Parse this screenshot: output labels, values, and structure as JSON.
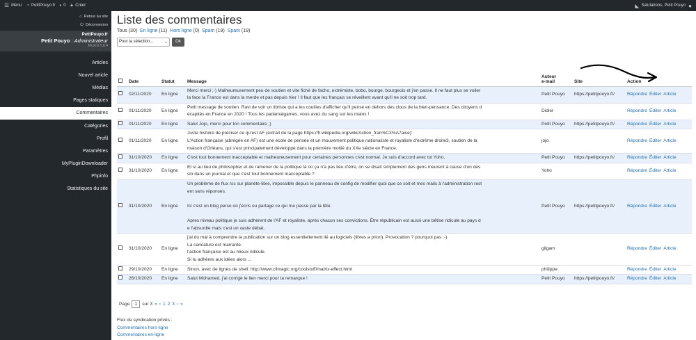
{
  "topbar": {
    "menu": "Menu",
    "site": "PetitPouyo.fr",
    "comments_count": "0",
    "create": "Créer",
    "greeting": "Salutations, Petit Pouyo"
  },
  "sidebar": {
    "back_link": "Retour au site",
    "logout": "Déconnexion",
    "site_name": "PetitPouyo.fr",
    "user_name": "Petit Pouyo",
    "user_role": "Administrateur",
    "version": "PluXml 5.8.4",
    "menu": [
      "Articles",
      "Nouvel article",
      "Médias",
      "Pages statiques",
      "Commentaires",
      "Catégories",
      "Profil",
      "Paramètres",
      "MyPluginDownloader",
      "Phpinfo",
      "Statistiques du site"
    ],
    "active": "Commentaires"
  },
  "page": {
    "title": "Liste des commentaires",
    "filters": {
      "all": "Tous (30)",
      "online": "En ligne",
      "online_count": "(11)",
      "offline": "Hors ligne",
      "offline_count": "(0)",
      "spam_a": "Spam",
      "spam_a_count": "(19)",
      "spam_b": "Spam",
      "spam_b_count": "(19)"
    },
    "bulk_select": "Pour la sélection...",
    "ok": "Ok"
  },
  "table": {
    "headers": {
      "date": "Date",
      "status": "Statut",
      "message": "Message",
      "author_a": "Auteur",
      "author_b": "e-mail",
      "site": "Site",
      "action": "Action"
    },
    "reply": "Répondre",
    "edit_comment": "Éditer",
    "article": "Article",
    "rows": [
      {
        "date": "02/11/2020",
        "status": "En ligne",
        "message": [
          "Merci merci ;-) Malheureusement peu de soutien et vite fiché de facho, extrémiste, bobo, bourge, bourgeois et j'en passe. Il ne faut plus se voiler",
          "la face la France est dans la merde et pas depuis hier ! Il faut que les français se réveillent avant qu'il ne soit trop tard."
        ],
        "author": "Petit Pouyo",
        "author_link": true,
        "site": "https://petitpouyo.fr/"
      },
      {
        "date": "01/11/2020",
        "status": "En ligne",
        "message": [
          "Petit message de soutien. Ravi de voir un libriste qui a les couilles d'afficher qu'il pense en dehors des clous de la bien-pensance. Des citoyens d",
          "écapités en France en 2020 ! Tous les padamalgames, vous avez du sang sur les mains !"
        ],
        "author": "Didier",
        "author_link": true,
        "site": ""
      },
      {
        "date": "01/11/2020",
        "status": "En ligne",
        "message": [
          "Salut Jojo, merci pour ton commentaire ;)"
        ],
        "author": "Petit Pouyo",
        "author_link": true,
        "site": "https://petitpouyo.fr/"
      },
      {
        "date": "01/11/2020",
        "status": "En ligne",
        "message": [
          "Juste histoire de préciser ce qu'est AF (extrait de la page https://fr.wikipedia.org/wiki/Action_fran%C3%A7aise):",
          "L'Action française (abrégée en AF) est une école de pensée et un mouvement politique nationaliste et royaliste d'extrême droite3, soutien de la",
          "maison d'Orléans, qui s'est principalement développé dans la première moitié du XXe siècle en France."
        ],
        "author": "jojo",
        "author_link": true,
        "site": ""
      },
      {
        "date": "31/10/2020",
        "status": "En ligne",
        "message": [
          "C'est tout bonnement inacceptable et malheureusement pour certaines personnes c'est normal. Je suis d'accord avec toi Yoho."
        ],
        "author": "Petit Pouyo",
        "author_link": true,
        "site": "https://petitpouyo.fr/"
      },
      {
        "date": "31/10/2020",
        "status": "En ligne",
        "message": [
          "Et si au lieu de philosopher et de ramener de la politique là où ça n'a pas lieu d'être, on se disait simplement des gens meurent à cause d'un des",
          "sin dans un journal et que c'est tout bonnement inacceptable ?"
        ],
        "author": "Yoho",
        "author_link": false,
        "site": ""
      },
      {
        "date": "31/10/2020",
        "status": "En ligne",
        "message": [
          "Un problème de flux rss sur planète-libre, impossible depuis le panneau de config de modifier quoi que ce soit et mes mails à l'administration rest",
          "ent sans réponses.",
          "",
          "Ici c'est un blog perso où j'écris ou partage ce qui me passe par la tête.",
          "",
          "Apres niveau politique je suis adhérent de l'AF et royaliste, après chacun ses convictions. Être républicain est aussi une bêtise ridicule au pays d",
          "e l'absurdie mais c'est un vaste débat."
        ],
        "author": "Petit Pouyo",
        "author_link": true,
        "site": "https://petitpouyo.fr/"
      },
      {
        "date": "31/10/2020",
        "status": "En ligne",
        "message": [
          "j'ai du mal à comprendre la publication sur un blog essentiellement lié au logiciels (libres a priori). Provocation ? pourquoi pas :-)",
          "La caricature est marrante.",
          "l'action française est au mieux ridicule.",
          "Si tu adhères aux idées alors ..."
        ],
        "author": "gilgam",
        "author_link": false,
        "site": ""
      },
      {
        "date": "29/10/2020",
        "status": "En ligne",
        "message": [
          "Sinon, avec de lignes de shell: http://www.climagic.org/coolstuff/matrix-effect.html"
        ],
        "author": "philippe",
        "author_link": false,
        "site": ""
      },
      {
        "date": "26/10/2020",
        "status": "En ligne",
        "message": [
          "Salut Mohamed, j'ai corrigé le lien merci pour ta remarque !"
        ],
        "author": "Petit Pouyo",
        "author_link": true,
        "site": "https://petitpouyo.fr/"
      }
    ]
  },
  "pagination": {
    "label": "Page",
    "current": "1",
    "of": "sur 3",
    "first": "«",
    "prev": "‹",
    "pages": [
      "1",
      "2",
      "3"
    ],
    "next": "›",
    "last": "»"
  },
  "syndication": {
    "label": "Flux de syndication privés :",
    "offline": "Commentaires hors-ligne",
    "online": "Commentaires en-ligne"
  }
}
